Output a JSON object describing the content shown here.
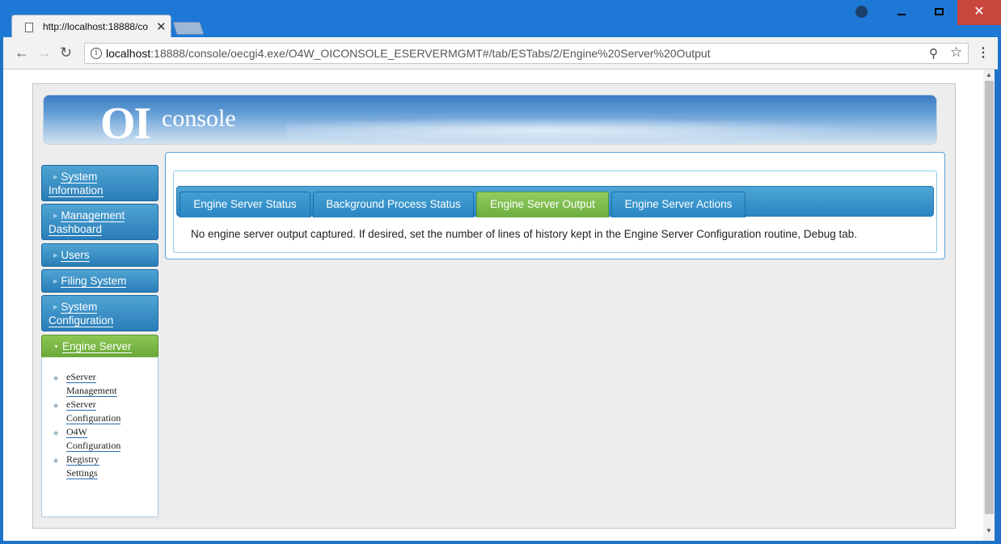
{
  "browser": {
    "tab_title": "http://localhost:18888/co",
    "url_host": "localhost",
    "url_rest": ":18888/console/oecgi4.exe/O4W_OICONSOLE_ESERVERMGMT#/tab/ESTabs/2/Engine%20Server%20Output"
  },
  "banner": {
    "logo_oi": "OI",
    "logo_console": "console"
  },
  "sidebar": {
    "items": [
      {
        "label_line1": "System",
        "label_line2": "Information"
      },
      {
        "label_line1": "Management",
        "label_line2": "Dashboard"
      },
      {
        "label": "Users"
      },
      {
        "label": "Filing System"
      },
      {
        "label_line1": "System",
        "label_line2": "Configuration"
      },
      {
        "label": "Engine Server"
      }
    ],
    "submenu": [
      {
        "line1": "eServer",
        "line2": "Management"
      },
      {
        "line1": "eServer",
        "line2": "Configuration"
      },
      {
        "line1": "O4W",
        "line2": "Configuration"
      },
      {
        "line1": "Registry",
        "line2": "Settings"
      }
    ]
  },
  "tabs": [
    {
      "label": "Engine Server Status"
    },
    {
      "label": "Background Process Status"
    },
    {
      "label": "Engine Server Output"
    },
    {
      "label": "Engine Server Actions"
    }
  ],
  "message": "No engine server output captured. If desired, set the number of lines of history kept in the Engine Server Configuration routine, Debug tab.",
  "colors": {
    "accent_blue": "#2a85c0",
    "active_green": "#6cae40",
    "window_blue": "#1e78d6"
  }
}
